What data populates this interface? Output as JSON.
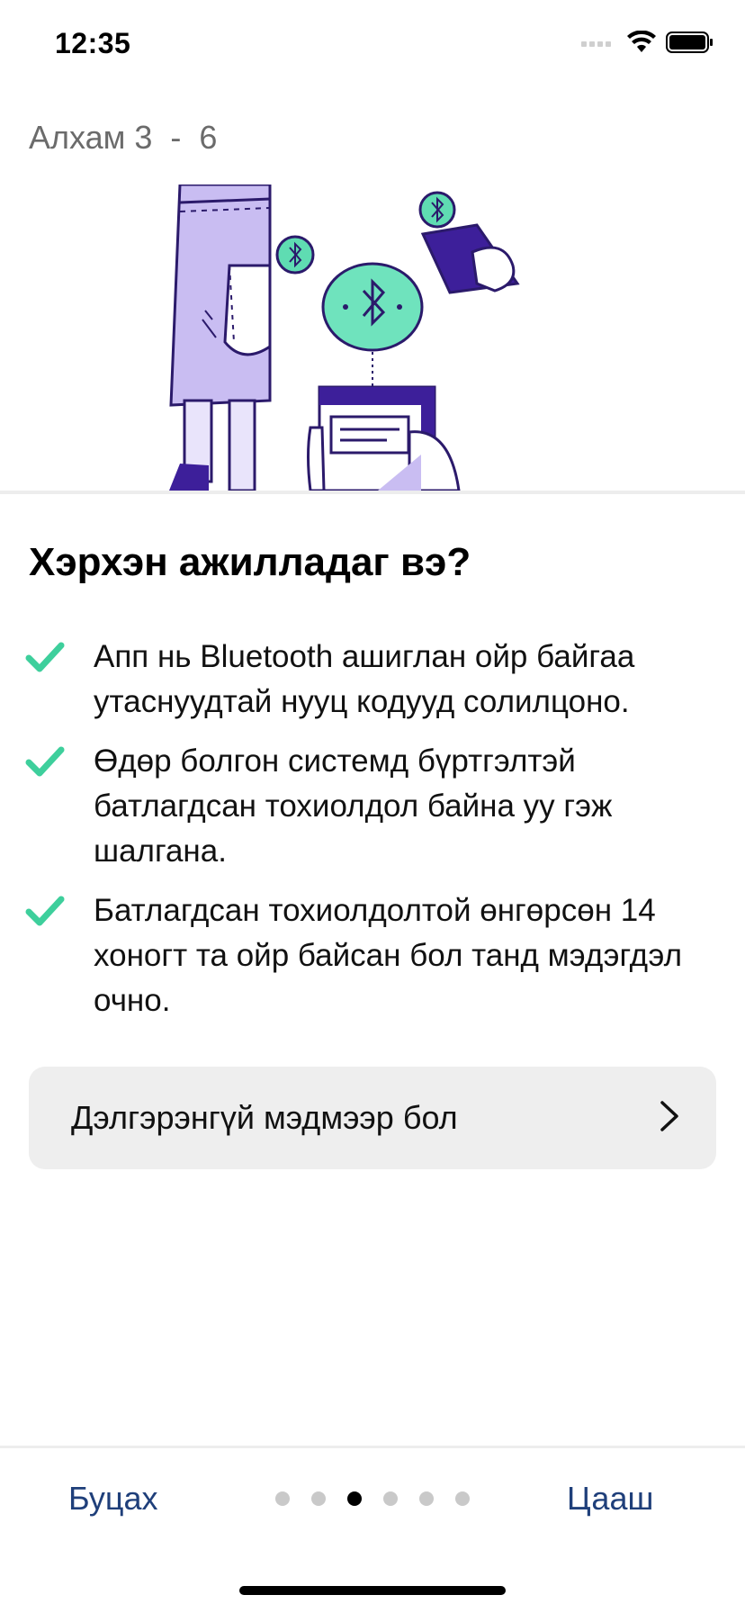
{
  "status_bar": {
    "time": "12:35"
  },
  "step": {
    "label": "Алхам 3  -  6"
  },
  "title": "Хэрхэн ажилладаг вэ?",
  "bullets": [
    {
      "text": "Апп нь Bluetooth ашиглан ойр байгаа утаснуудтай нууц кодууд солилцоно."
    },
    {
      "text": "Өдөр болгон системд бүртгэлтэй батлагдсан тохиолдол байна уу гэж шалгана."
    },
    {
      "text": "Батлагдсан тохиолдолтой өнгөрсөн 14 хоногт та ойр байсан бол танд мэдэгдэл очно."
    }
  ],
  "more_button": {
    "label": "Дэлгэрэнгүй мэдмээр бол",
    "icon": "chevron-right-icon"
  },
  "footer": {
    "back_label": "Буцах",
    "next_label": "Цааш",
    "pages_total": 6,
    "pages_current": 3
  },
  "colors": {
    "accent": "#3ecf9c",
    "nav_text": "#1f3f7a",
    "illustration_purple": "#3d1f9a",
    "illustration_lavender": "#c9bdf2"
  }
}
